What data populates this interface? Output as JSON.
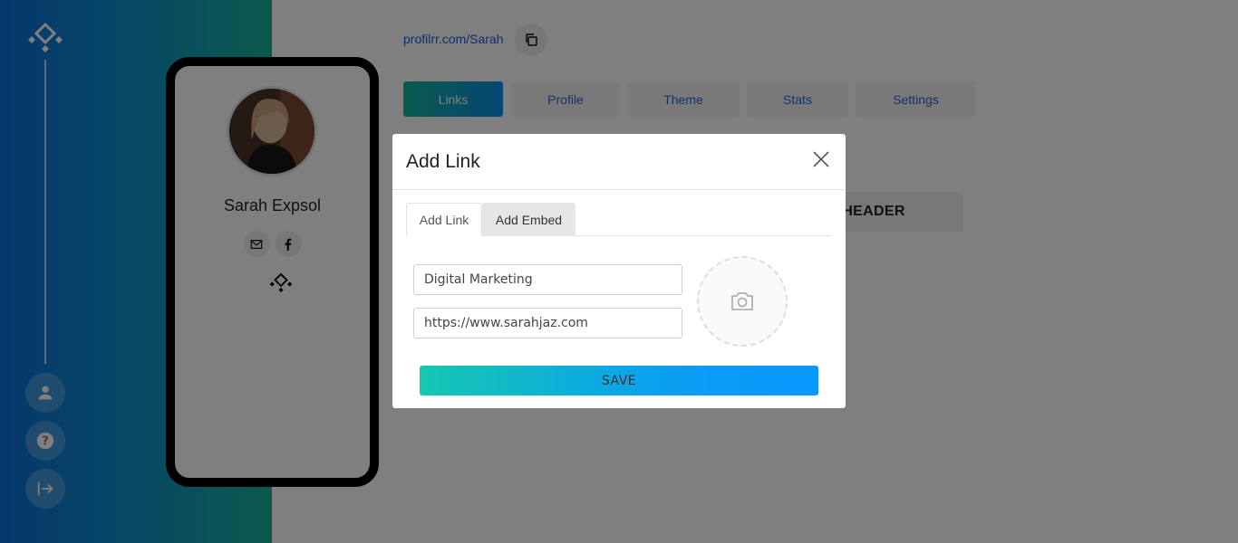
{
  "profile": {
    "url_text": "profilrr.com/Sarah",
    "name": "Sarah Expsol"
  },
  "nav_tabs": [
    {
      "label": "Links",
      "active": true
    },
    {
      "label": "Profile",
      "active": false
    },
    {
      "label": "Theme",
      "active": false
    },
    {
      "label": "Stats",
      "active": false
    },
    {
      "label": "Settings",
      "active": false
    }
  ],
  "content": {
    "header_button_label": "HEADER"
  },
  "sidebar": {
    "icons": [
      "logo-icon",
      "user-icon",
      "help-icon",
      "logout-icon"
    ]
  },
  "phone_preview": {
    "social_icons": [
      "email-icon",
      "facebook-icon"
    ]
  },
  "modal": {
    "title": "Add Link",
    "tabs": [
      {
        "label": "Add Link",
        "active": true
      },
      {
        "label": "Add Embed",
        "active": false
      }
    ],
    "title_field_value": "Digital Marketing",
    "url_field_value": "https://www.sarahjaz.com",
    "save_label": "SAVE"
  },
  "colors": {
    "brand_gradient_start": "#15b39a",
    "brand_gradient_end": "#0a8fe6",
    "link_blue": "#1e5bd6"
  }
}
